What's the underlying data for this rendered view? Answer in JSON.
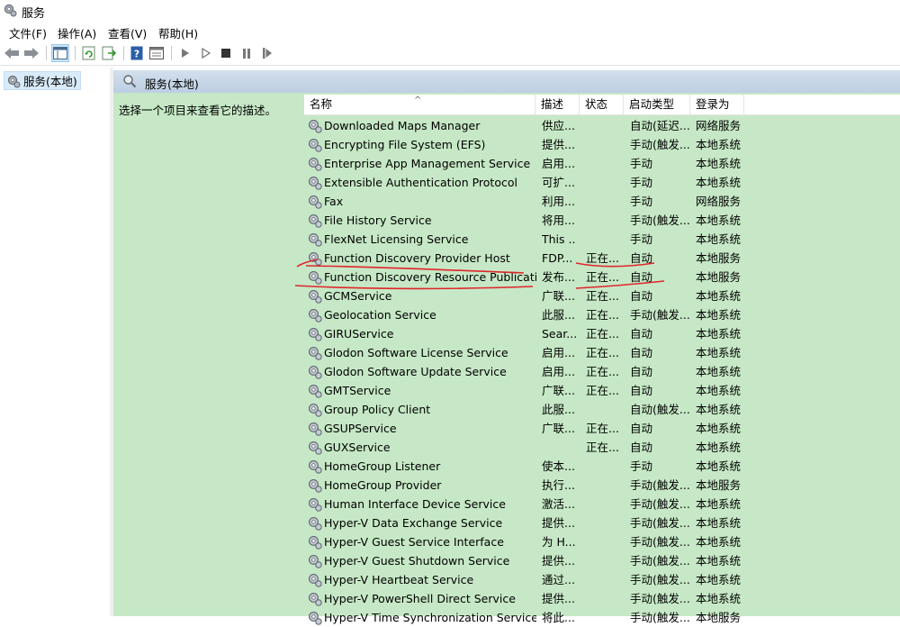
{
  "window": {
    "title": "服务"
  },
  "menu": [
    "文件(F)",
    "操作(A)",
    "查看(V)",
    "帮助(H)"
  ],
  "tree": {
    "root_label": "服务(本地)"
  },
  "pane": {
    "header_title": "服务(本地)",
    "description": "选择一个项目来查看它的描述。"
  },
  "columns": {
    "name": "名称",
    "desc": "描述",
    "status": "状态",
    "startup": "启动类型",
    "logon": "登录为"
  },
  "services": [
    {
      "name": "Downloaded Maps Manager",
      "desc": "供应...",
      "status": "",
      "startup": "自动(延迟...",
      "logon": "网络服务"
    },
    {
      "name": "Encrypting File System (EFS)",
      "desc": "提供...",
      "status": "",
      "startup": "手动(触发...",
      "logon": "本地系统"
    },
    {
      "name": "Enterprise App Management Service",
      "desc": "启用...",
      "status": "",
      "startup": "手动",
      "logon": "本地系统"
    },
    {
      "name": "Extensible Authentication Protocol",
      "desc": "可扩...",
      "status": "",
      "startup": "手动",
      "logon": "本地系统"
    },
    {
      "name": "Fax",
      "desc": "利用...",
      "status": "",
      "startup": "手动",
      "logon": "网络服务"
    },
    {
      "name": "File History Service",
      "desc": "将用...",
      "status": "",
      "startup": "手动(触发...",
      "logon": "本地系统"
    },
    {
      "name": "FlexNet Licensing Service",
      "desc": "This ...",
      "status": "",
      "startup": "手动",
      "logon": "本地系统"
    },
    {
      "name": "Function Discovery Provider Host",
      "desc": "FDP...",
      "status": "正在...",
      "startup": "自动",
      "logon": "本地服务"
    },
    {
      "name": "Function Discovery Resource Publication",
      "desc": "发布...",
      "status": "正在...",
      "startup": "自动",
      "logon": "本地服务"
    },
    {
      "name": "GCMService",
      "desc": "广联...",
      "status": "正在...",
      "startup": "自动",
      "logon": "本地系统"
    },
    {
      "name": "Geolocation Service",
      "desc": "此服...",
      "status": "正在...",
      "startup": "手动(触发...",
      "logon": "本地系统"
    },
    {
      "name": "GIRUService",
      "desc": "Sear...",
      "status": "正在...",
      "startup": "自动",
      "logon": "本地系统"
    },
    {
      "name": "Glodon Software License Service",
      "desc": "启用...",
      "status": "正在...",
      "startup": "自动",
      "logon": "本地系统"
    },
    {
      "name": "Glodon Software Update Service",
      "desc": "启用...",
      "status": "正在...",
      "startup": "自动",
      "logon": "本地系统"
    },
    {
      "name": "GMTService",
      "desc": "广联...",
      "status": "正在...",
      "startup": "自动",
      "logon": "本地系统"
    },
    {
      "name": "Group Policy Client",
      "desc": "此服...",
      "status": "",
      "startup": "自动(触发...",
      "logon": "本地系统"
    },
    {
      "name": "GSUPService",
      "desc": "广联...",
      "status": "正在...",
      "startup": "自动",
      "logon": "本地系统"
    },
    {
      "name": "GUXService",
      "desc": "",
      "status": "正在...",
      "startup": "自动",
      "logon": "本地系统"
    },
    {
      "name": "HomeGroup Listener",
      "desc": "使本...",
      "status": "",
      "startup": "手动",
      "logon": "本地系统"
    },
    {
      "name": "HomeGroup Provider",
      "desc": "执行...",
      "status": "",
      "startup": "手动(触发...",
      "logon": "本地服务"
    },
    {
      "name": "Human Interface Device Service",
      "desc": "激活...",
      "status": "",
      "startup": "手动(触发...",
      "logon": "本地系统"
    },
    {
      "name": "Hyper-V Data Exchange Service",
      "desc": "提供...",
      "status": "",
      "startup": "手动(触发...",
      "logon": "本地系统"
    },
    {
      "name": "Hyper-V Guest Service Interface",
      "desc": "为 H...",
      "status": "",
      "startup": "手动(触发...",
      "logon": "本地系统"
    },
    {
      "name": "Hyper-V Guest Shutdown Service",
      "desc": "提供...",
      "status": "",
      "startup": "手动(触发...",
      "logon": "本地系统"
    },
    {
      "name": "Hyper-V Heartbeat Service",
      "desc": "通过...",
      "status": "",
      "startup": "手动(触发...",
      "logon": "本地系统"
    },
    {
      "name": "Hyper-V PowerShell Direct Service",
      "desc": "提供...",
      "status": "",
      "startup": "手动(触发...",
      "logon": "本地系统"
    },
    {
      "name": "Hyper-V Time Synchronization Service",
      "desc": "将此...",
      "status": "",
      "startup": "手动(触发...",
      "logon": "本地服务"
    }
  ],
  "colors": {
    "list_bg": "#c6e8c6",
    "header_bg": "#c9d9ea",
    "annotation": "#e0262b"
  }
}
